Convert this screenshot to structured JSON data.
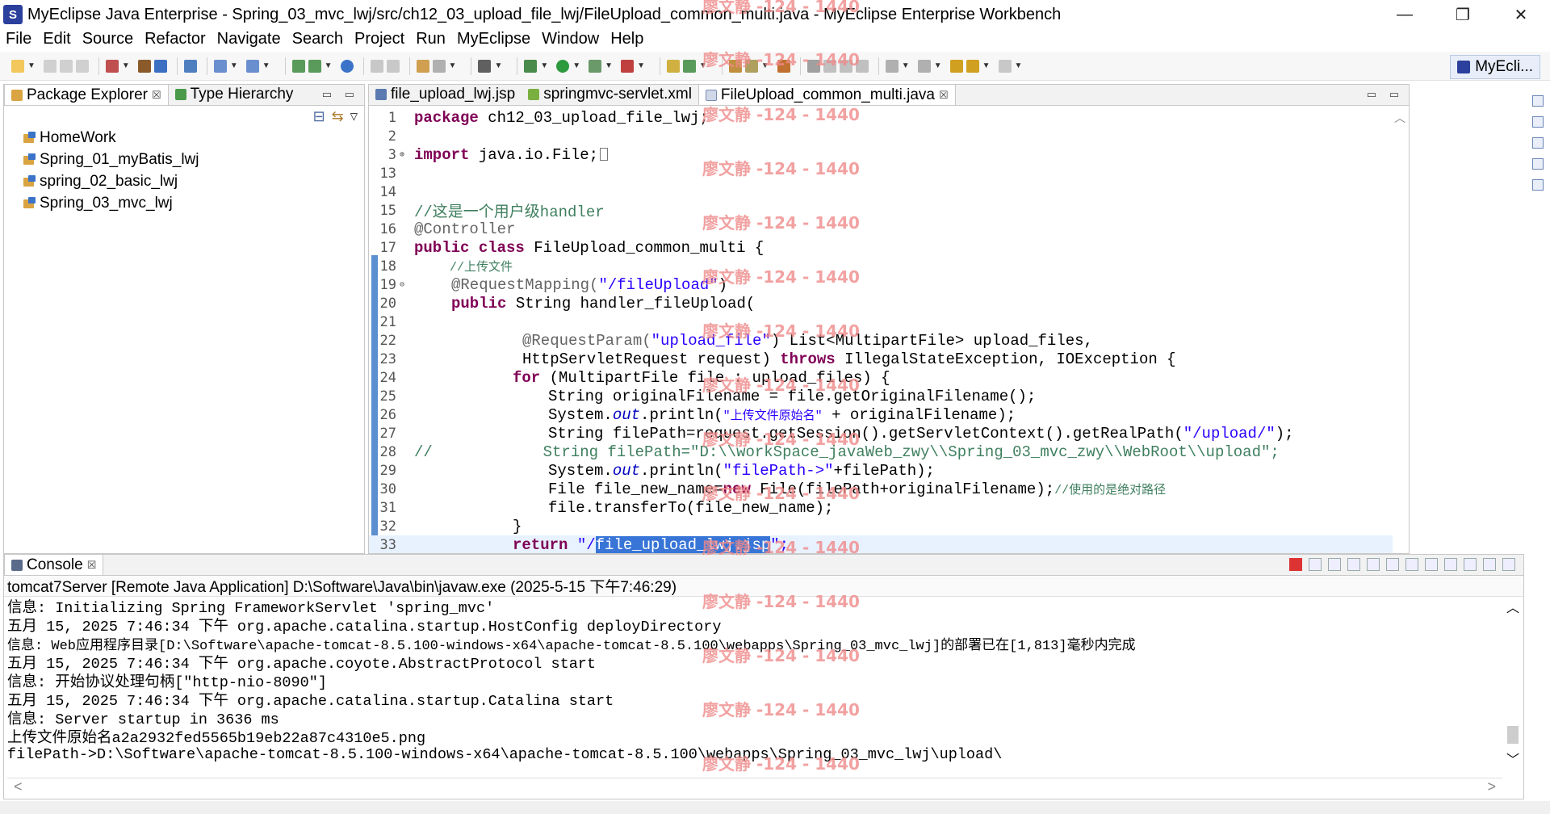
{
  "window": {
    "title": "MyEclipse Java Enterprise - Spring_03_mvc_lwj/src/ch12_03_upload_file_lwj/FileUpload_common_multi.java - MyEclipse Enterprise Workbench",
    "logo_glyph": "S",
    "minimize": "—",
    "restore": "❐",
    "close": "✕"
  },
  "menu": [
    "File",
    "Edit",
    "Source",
    "Refactor",
    "Navigate",
    "Search",
    "Project",
    "Run",
    "MyEclipse",
    "Window",
    "Help"
  ],
  "perspective": {
    "label": "MyEcli..."
  },
  "left_pane": {
    "tabs": [
      {
        "label": "Package Explorer",
        "close": "☒"
      },
      {
        "label": "Type Hierarchy"
      }
    ],
    "controls": "▭ ▭",
    "tree_toolbar": {
      "collapse": "⊟",
      "link": "⇆",
      "menu": "▽"
    },
    "projects": [
      "HomeWork",
      "Spring_01_myBatis_lwj",
      "spring_02_basic_lwj",
      "Spring_03_mvc_lwj"
    ]
  },
  "editor": {
    "tabs": [
      {
        "label": "file_upload_lwj.jsp"
      },
      {
        "label": "springmvc-servlet.xml"
      },
      {
        "label": "FileUpload_common_multi.java",
        "close": "☒"
      }
    ],
    "controls": "▭ ▭",
    "line_numbers": [
      "1",
      "2",
      "3",
      "13",
      "14",
      "15",
      "16",
      "17",
      "18",
      "19",
      "20",
      "21",
      "22",
      "23",
      "24",
      "25",
      "26",
      "27",
      "28",
      "29",
      "30",
      "31",
      "32",
      "33"
    ],
    "fold_markers": {
      "3": "⊕",
      "19": "⊖"
    },
    "lines": {
      "l1_kw": "package",
      "l1_rest": " ch12_03_upload_file_lwj;",
      "l3_kw": "import",
      "l3_rest": " java.io.File;",
      "l15": "//这是一个用户级handler",
      "l16": "@Controller",
      "l17_kw1": "public",
      "l17_kw2": "class",
      "l17_rest": " FileUpload_common_multi {",
      "l18": "//上传文件",
      "l19_ann": "@RequestMapping(",
      "l19_str": "\"/fileUpload\"",
      "l19_end": ")",
      "l20_kw": "public",
      "l20_rest": " String handler_fileUpload(",
      "l22_ann": "@RequestParam(",
      "l22_str": "\"upload_file\"",
      "l22_rest": ") List<MultipartFile> upload_files,",
      "l23_a": "HttpServletRequest request) ",
      "l23_kw": "throws",
      "l23_b": " IllegalStateException, IOException {",
      "l24_kw": "for",
      "l24_rest": " (MultipartFile file : upload_files) {",
      "l25": "String originalFilename = file.getOriginalFilename();",
      "l26_a": "System.",
      "l26_it": "out",
      "l26_b": ".println(",
      "l26_str": "\"上传文件原始名\"",
      "l26_c": " + originalFilename);",
      "l27_a": "String filePath=request.getSession().getServletContext().getRealPath(",
      "l27_str": "\"/upload/\"",
      "l27_b": ");",
      "l28": "//            String filePath=\"D:\\\\workSpace_javaWeb_zwy\\\\Spring_03_mvc_zwy\\\\WebRoot\\\\upload\";",
      "l29_a": "System.",
      "l29_it": "out",
      "l29_b": ".println(",
      "l29_str": "\"filePath->\"",
      "l29_c": "+filePath);",
      "l30_a": "File file_new_name=",
      "l30_kw": "new",
      "l30_b": " File(filePath+originalFilename);",
      "l30_cm": "//使用的是绝对路径",
      "l31": "file.transferTo(file_new_name);",
      "l32": "}",
      "l33_kw": "return",
      "l33_q1": " \"/",
      "l33_sel": "file_upload_lwj.jsp",
      "l33_q2": "\";"
    }
  },
  "console": {
    "tab": {
      "label": "Console",
      "close": "☒"
    },
    "header": "tomcat7Server [Remote Java Application] D:\\Software\\Java\\bin\\javaw.exe (2025-5-15 下午7:46:29)",
    "lines": [
      "信息: Initializing Spring FrameworkServlet 'spring_mvc'",
      "五月 15, 2025 7:46:34 下午 org.apache.catalina.startup.HostConfig deployDirectory",
      "信息: Web应用程序目录[D:\\Software\\apache-tomcat-8.5.100-windows-x64\\apache-tomcat-8.5.100\\webapps\\Spring_03_mvc_lwj]的部署已在[1,813]毫秒内完成",
      "五月 15, 2025 7:46:34 下午 org.apache.coyote.AbstractProtocol start",
      "信息: 开始协议处理句柄[\"http-nio-8090\"]",
      "五月 15, 2025 7:46:34 下午 org.apache.catalina.startup.Catalina start",
      "信息: Server startup in 3636 ms",
      "上传文件原始名a2a2932fed5565b19eb22a87c4310e5.png",
      "filePath->D:\\Software\\apache-tomcat-8.5.100-windows-x64\\apache-tomcat-8.5.100\\webapps\\Spring_03_mvc_lwj\\upload\\"
    ],
    "scroll_up": "︿",
    "scroll_down": "﹀",
    "scroll_left": "<",
    "scroll_right": ">"
  },
  "watermark": "廖文静 -124 - 1440",
  "colors": {
    "keyword": "#7f0055",
    "comment": "#3f7f5f",
    "string": "#2a00ff",
    "selection": "#3875d7",
    "watermark": "#f08a8a"
  }
}
